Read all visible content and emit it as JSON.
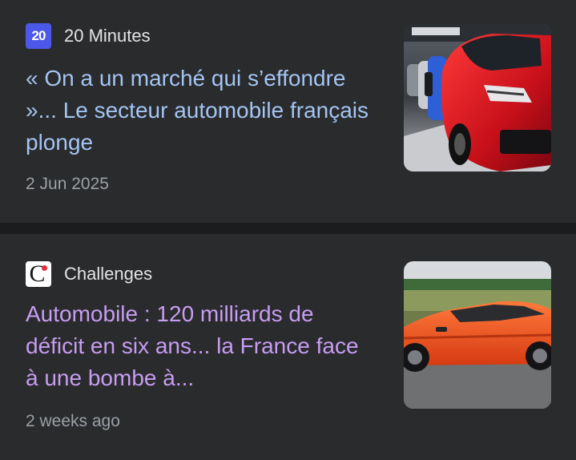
{
  "articles": [
    {
      "source": "20 Minutes",
      "logo_text": "20",
      "logo_icon": "20-minutes-logo-icon",
      "headline": "« On a un marché qui s’effondre »... Le secteur automobile français plonge",
      "date": "2 Jun 2025",
      "headline_color": "#a4c4f2",
      "thumbnail": "red-car-production-line-image"
    },
    {
      "source": "Challenges",
      "logo_icon": "challenges-logo-icon",
      "headline": "Automobile : 120 milliards de déficit en six ans... la France face à une bombe à...",
      "date": "2 weeks ago",
      "headline_color": "#c79df2",
      "thumbnail": "orange-car-road-image"
    }
  ]
}
